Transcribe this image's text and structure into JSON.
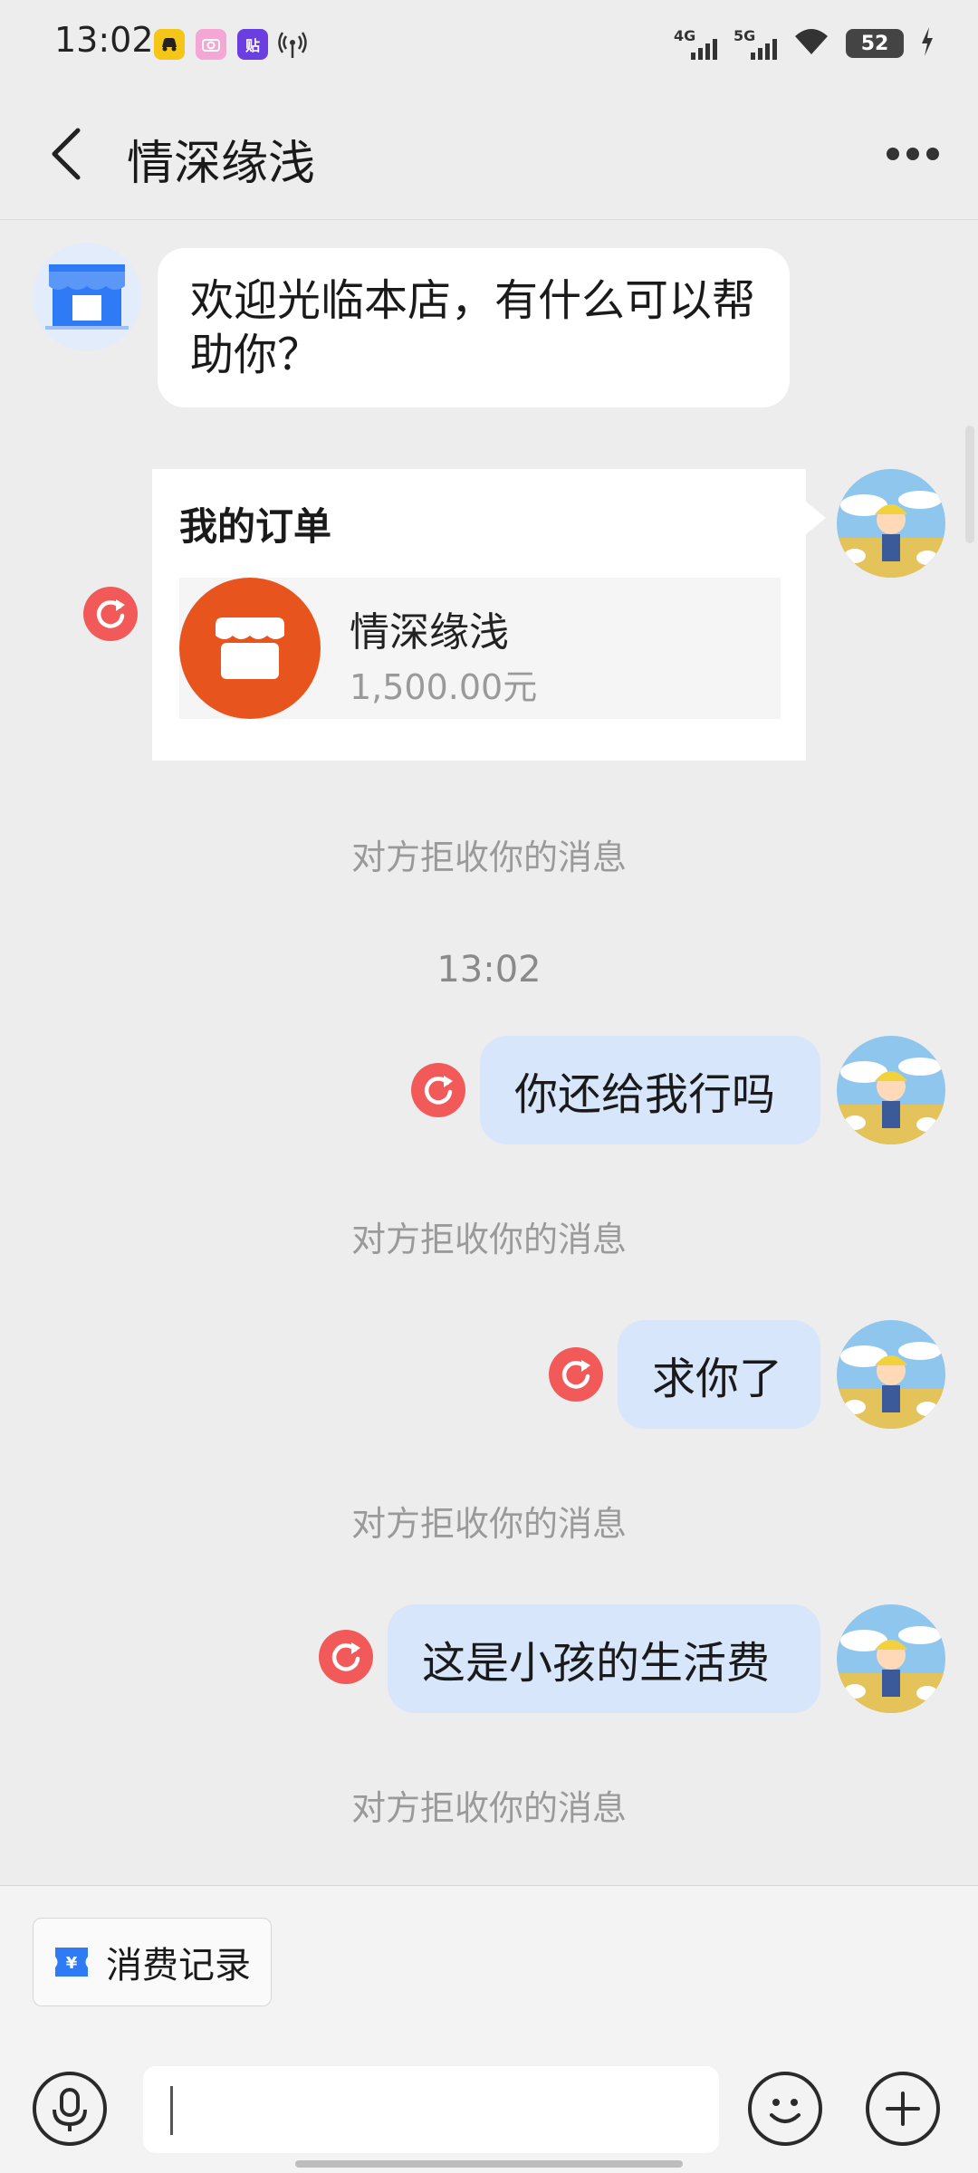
{
  "status_bar": {
    "time": "13:02",
    "network_4g": "4G",
    "network_5g": "5G",
    "battery": "52",
    "icons": [
      "car-app-icon",
      "camera-app-icon",
      "sticker-app-icon",
      "hotspot-icon",
      "wifi-icon",
      "charging-icon"
    ]
  },
  "header": {
    "back_icon": "chevron-left-icon",
    "title": "情深缘浅",
    "more_icon": "more-dots-icon"
  },
  "messages": {
    "welcome": "欢迎光临本店，有什么可以帮助你？",
    "order_card": {
      "title": "我的订单",
      "shop_name": "情深缘浅",
      "price": "1,500.00元"
    },
    "rejected_notice": "对方拒收你的消息",
    "timestamp": "13:02",
    "msg1": "你还给我行吗",
    "msg2": "求你了",
    "msg3": "这是小孩的生活费"
  },
  "bottom": {
    "quick_action": "消费记录",
    "voice_icon": "microphone-icon",
    "emoji_icon": "smiley-icon",
    "plus_icon": "plus-icon",
    "input_value": ""
  },
  "colors": {
    "bubble_self": "#d7e6fb",
    "resend_red": "#f25a5a",
    "shop_orange": "#e8541e",
    "background": "#ededed"
  }
}
